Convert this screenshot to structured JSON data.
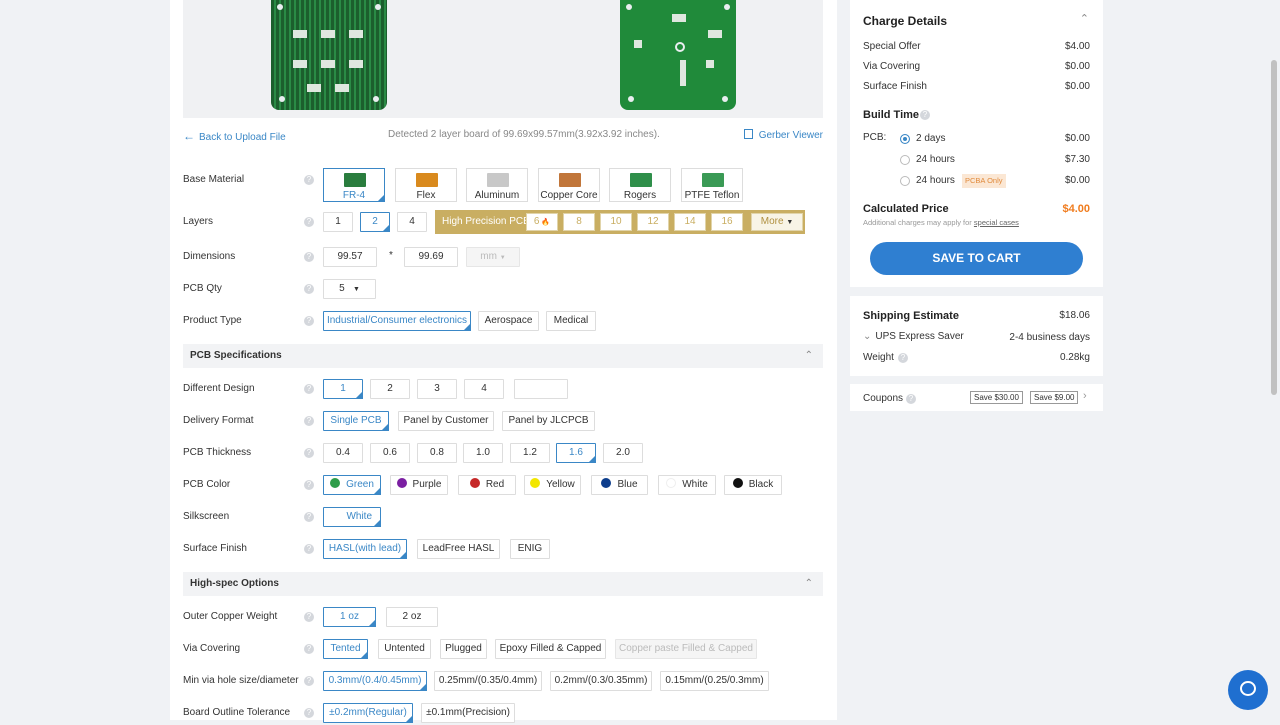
{
  "nav": {
    "back": "Back to Upload File",
    "detected": "Detected 2 layer board of 99.69x99.57mm(3.92x3.92 inches).",
    "gerber": "Gerber Viewer"
  },
  "help_glyph": "?",
  "base_material": {
    "label": "Base Material",
    "options": [
      "FR-4",
      "Flex",
      "Aluminum",
      "Copper Core",
      "Rogers",
      "PTFE Teflon"
    ],
    "selected": "FR-4"
  },
  "layers": {
    "label": "Layers",
    "options": [
      "1",
      "2",
      "4"
    ],
    "selected": "2",
    "high_precision_title": "High Precision PCB",
    "high_precision_options": [
      "6",
      "8",
      "10",
      "12",
      "14",
      "16"
    ],
    "hot_icon": "🔥",
    "more": "More"
  },
  "dimensions": {
    "label": "Dimensions",
    "width": "99.57",
    "height": "99.69",
    "separator": "*",
    "unit": "mm"
  },
  "qty": {
    "label": "PCB Qty",
    "value": "5"
  },
  "product_type": {
    "label": "Product Type",
    "options": [
      "Industrial/Consumer electronics",
      "Aerospace",
      "Medical"
    ],
    "selected": "Industrial/Consumer electronics"
  },
  "sections": {
    "specs": "PCB Specifications",
    "highspec": "High-spec Options"
  },
  "different_design": {
    "label": "Different Design",
    "options": [
      "1",
      "2",
      "3",
      "4",
      ""
    ],
    "selected": "1"
  },
  "delivery_format": {
    "label": "Delivery Format",
    "options": [
      "Single PCB",
      "Panel by Customer",
      "Panel by JLCPCB"
    ],
    "selected": "Single PCB"
  },
  "thickness": {
    "label": "PCB Thickness",
    "options": [
      "0.4",
      "0.6",
      "0.8",
      "1.0",
      "1.2",
      "1.6",
      "2.0"
    ],
    "selected": "1.6"
  },
  "color": {
    "label": "PCB Color",
    "options": [
      {
        "name": "Green",
        "color": "#2e9d4a"
      },
      {
        "name": "Purple",
        "color": "#7b1fa2"
      },
      {
        "name": "Red",
        "color": "#c62828"
      },
      {
        "name": "Yellow",
        "color": "#f2e600"
      },
      {
        "name": "Blue",
        "color": "#0d3d8c"
      },
      {
        "name": "White",
        "color": "#ffffff"
      },
      {
        "name": "Black",
        "color": "#111111"
      }
    ],
    "selected": "Green"
  },
  "silkscreen": {
    "label": "Silkscreen",
    "value": "White"
  },
  "surface_finish": {
    "label": "Surface Finish",
    "options": [
      "HASL(with lead)",
      "LeadFree HASL",
      "ENIG"
    ],
    "selected": "HASL(with lead)"
  },
  "outer_copper": {
    "label": "Outer Copper Weight",
    "options": [
      "1 oz",
      "2 oz"
    ],
    "selected": "1 oz"
  },
  "via_covering": {
    "label": "Via Covering",
    "options": [
      "Tented",
      "Untented",
      "Plugged",
      "Epoxy Filled & Capped",
      "Copper paste Filled & Capped"
    ],
    "selected": "Tented"
  },
  "min_via": {
    "label": "Min via hole size/diameter",
    "options": [
      "0.3mm/(0.4/0.45mm)",
      "0.25mm/(0.35/0.4mm)",
      "0.2mm/(0.3/0.35mm)",
      "0.15mm/(0.25/0.3mm)"
    ],
    "selected": "0.3mm/(0.4/0.45mm)"
  },
  "outline_tolerance": {
    "label": "Board Outline Tolerance",
    "options": [
      "±0.2mm(Regular)",
      "±0.1mm(Precision)"
    ],
    "selected": "±0.2mm(Regular)"
  },
  "charges": {
    "title": "Charge Details",
    "items": [
      {
        "name": "Special Offer",
        "value": "$4.00"
      },
      {
        "name": "Via Covering",
        "value": "$0.00"
      },
      {
        "name": "Surface Finish",
        "value": "$0.00"
      }
    ]
  },
  "build_time": {
    "title": "Build Time",
    "pcb_label": "PCB:",
    "options": [
      {
        "label": "2 days",
        "price": "$0.00",
        "badge": ""
      },
      {
        "label": "24 hours",
        "price": "$7.30",
        "badge": ""
      },
      {
        "label": "24 hours",
        "price": "$0.00",
        "badge": "PCBA Only"
      }
    ],
    "selected_index": 0
  },
  "calculated": {
    "title": "Calculated Price",
    "value": "$4.00",
    "note_prefix": "Additional charges may apply for ",
    "note_link": "special cases"
  },
  "save_button": "SAVE TO CART",
  "shipping": {
    "title": "Shipping Estimate",
    "price": "$18.06",
    "carrier": "UPS Express Saver",
    "days": "2-4 business days",
    "weight_label": "Weight",
    "weight": "0.28kg"
  },
  "coupons": {
    "label": "Coupons",
    "items": [
      "Save $30.00",
      "Save $9.00"
    ]
  },
  "colors": {
    "accent": "#3a87c6",
    "price_orange": "#f07c1e",
    "gold": "#c9ae62",
    "button_blue": "#2f7fd1"
  }
}
